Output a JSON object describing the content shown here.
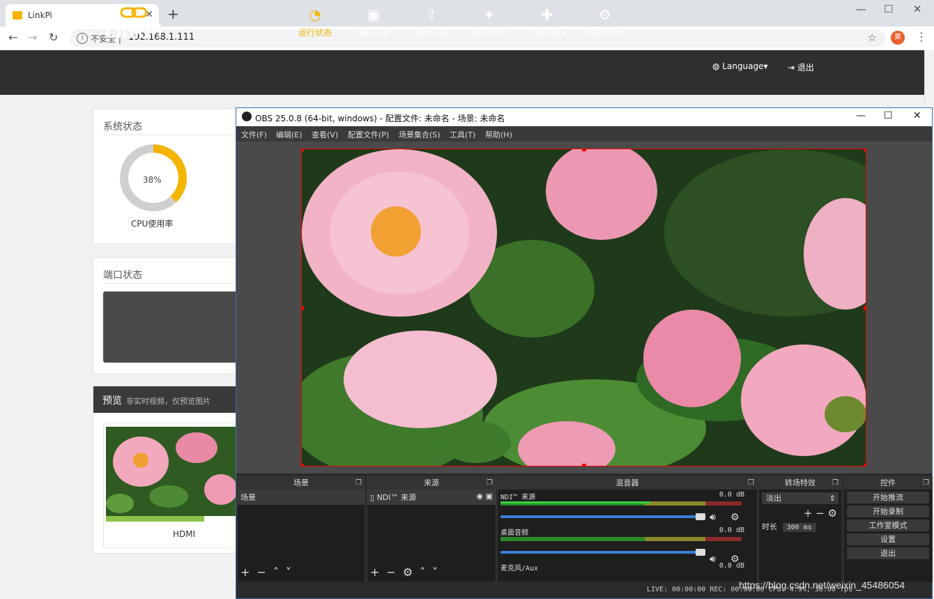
{
  "browser": {
    "tab_title": "LinkPi",
    "insecure_label": "不安全",
    "separator": "|",
    "url": "192.168.1.111",
    "profile_initial": "果"
  },
  "nav": {
    "logo": "LinkPi",
    "items": [
      {
        "label": "运行状态",
        "icon": "dashboard-icon",
        "active": true
      },
      {
        "label": "编码设置",
        "icon": "image-icon"
      },
      {
        "label": "输出设置",
        "icon": "upload-icon"
      },
      {
        "label": "叠加特效",
        "icon": "magic-wand-icon"
      },
      {
        "label": "扩展功能▾",
        "icon": "puzzle-icon"
      },
      {
        "label": "高级设置▾",
        "icon": "gears-icon"
      }
    ],
    "language": "Language▾",
    "logout": "退出"
  },
  "system_status": {
    "title": "系统状态",
    "cpu_percent_text": "38%",
    "cpu_fraction": 0.38,
    "cpu_label": "CPU使用率"
  },
  "port_status": {
    "title": "端口状态"
  },
  "preview": {
    "title": "预览",
    "subtitle": "非实时视频，仅预览图片",
    "label": "HDMI",
    "progress": 0.74
  },
  "obs": {
    "title": "OBS 25.0.8 (64-bit, windows) - 配置文件: 未命名 - 场景: 未命名",
    "menu": [
      "文件(F)",
      "编辑(E)",
      "查看(V)",
      "配置文件(P)",
      "场景集合(S)",
      "工具(T)",
      "帮助(H)"
    ],
    "docks": {
      "scenes": {
        "title": "场景",
        "items": [
          "场景"
        ]
      },
      "sources": {
        "title": "来源",
        "items": [
          "NDI™ 来源"
        ]
      },
      "mixer": {
        "title": "混音器",
        "channels": [
          {
            "name": "NDI™ 来源",
            "db": "0.0 dB",
            "level": 0.62
          },
          {
            "name": "桌面音频",
            "db": "0.0 dB",
            "level": 0.0
          },
          {
            "name": "麦克风/Aux",
            "db": "0.0 dB",
            "level": 0.0
          }
        ]
      },
      "transitions": {
        "title": "转场特效",
        "selected": "淡出",
        "duration_label": "时长",
        "duration_value": "300 ms"
      },
      "controls": {
        "title": "控件",
        "buttons": [
          "开始推流",
          "开始录制",
          "工作室模式",
          "设置",
          "退出"
        ]
      }
    },
    "status": "LIVE: 00:00:00   REC: 00:00:00   CPU: 4.9%, 30.00 fps"
  },
  "watermark": "https://blog.csdn.net/weixin_45486054",
  "colors": {
    "accent": "#f5b400",
    "obs_border": "#e00000",
    "nav_bg": "#2f2f2f"
  }
}
